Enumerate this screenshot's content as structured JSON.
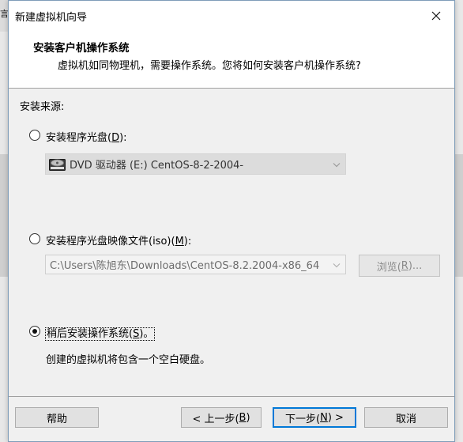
{
  "background": {
    "partial_label": "言"
  },
  "window": {
    "title": "新建虚拟机向导",
    "close_glyph": "✕"
  },
  "header": {
    "title": "安装客户机操作系统",
    "subtitle": "虚拟机如同物理机，需要操作系统。您将如何安装客户机操作系统?"
  },
  "source_label": "安装来源:",
  "options": {
    "disc": {
      "label_prefix": "安装程序光盘(",
      "mnemonic": "D",
      "label_suffix": "):",
      "selected": false,
      "combo_value": "DVD 驱动器 (E:) CentOS-8-2-2004-"
    },
    "iso": {
      "label_prefix": "安装程序光盘映像文件(iso)(",
      "mnemonic": "M",
      "label_suffix": "):",
      "selected": false,
      "combo_value": "C:\\Users\\陈旭东\\Downloads\\CentOS-8.2.2004-x86_64",
      "browse_prefix": "浏览(",
      "browse_mnemonic": "R",
      "browse_suffix": ")..."
    },
    "later": {
      "label_prefix": "稍后安装操作系统(",
      "mnemonic": "S",
      "label_suffix": ")。",
      "selected": true,
      "description": "创建的虚拟机将包含一个空白硬盘。"
    }
  },
  "buttons": {
    "help": "帮助",
    "back_prefix": "< 上一步(",
    "back_mnemonic": "B",
    "back_suffix": ")",
    "next_prefix": "下一步(",
    "next_mnemonic": "N",
    "next_suffix": ") >",
    "cancel": "取消"
  },
  "icons": {
    "close": "close-icon",
    "chevron": "chevron-down-icon",
    "dvd": "dvd-drive-icon"
  },
  "colors": {
    "default_button_border": "#0078d7",
    "header_bg": "#ffffff",
    "dialog_bg": "#f0f0f0"
  }
}
